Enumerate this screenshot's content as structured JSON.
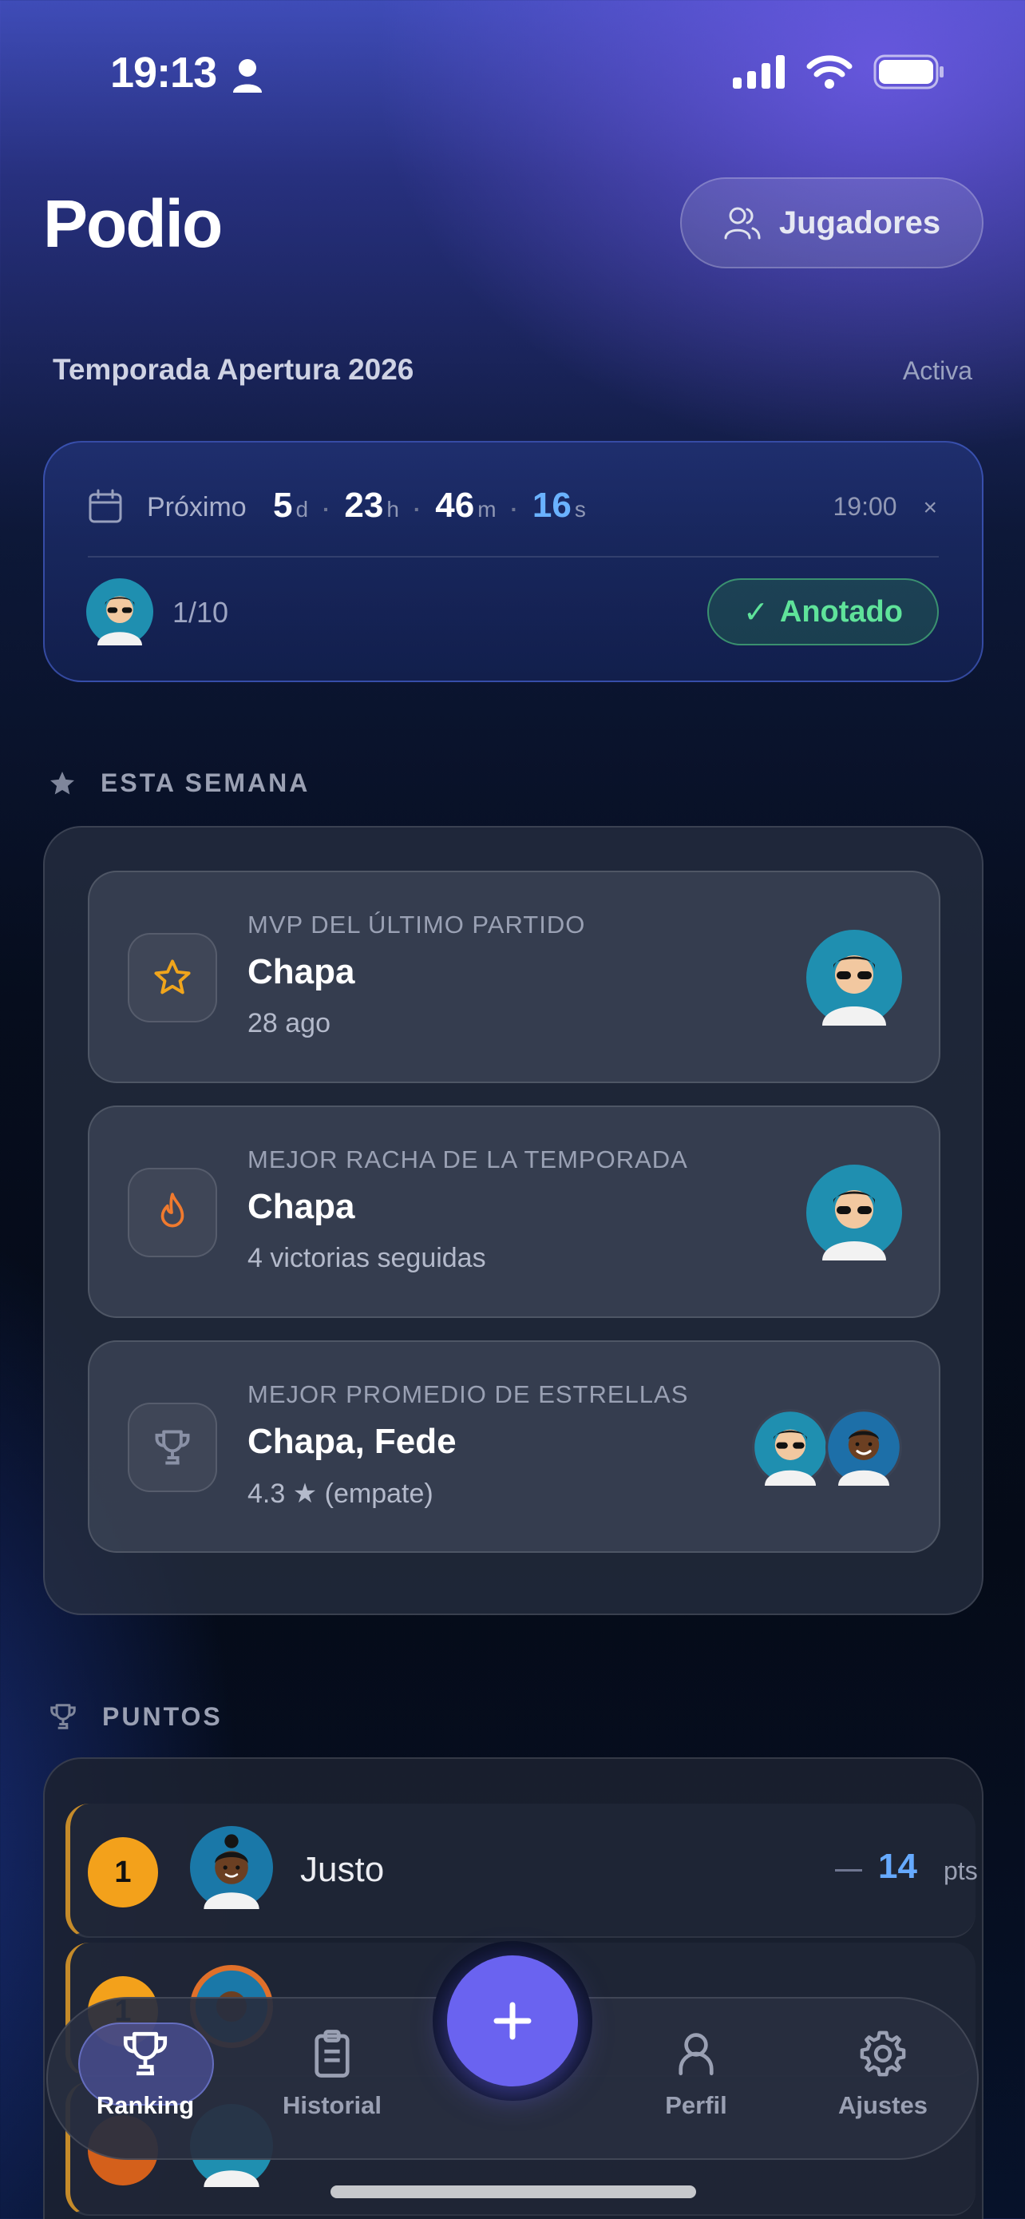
{
  "status_bar": {
    "time": "19:13"
  },
  "header": {
    "title": "Podio",
    "players_button": "Jugadores"
  },
  "season": {
    "name": "Temporada Apertura 2026",
    "status": "Activa"
  },
  "next_match": {
    "label": "Próximo",
    "countdown": {
      "days": "5",
      "days_unit": "d",
      "hours": "23",
      "hours_unit": "h",
      "minutes": "46",
      "minutes_unit": "m",
      "seconds": "16",
      "seconds_unit": "s"
    },
    "time": "19:00",
    "close_glyph": "×",
    "signed_count": "1/10",
    "joined_label": "Anotado",
    "check_glyph": "✓"
  },
  "week": {
    "heading": "ESTA SEMANA",
    "awards": [
      {
        "kicker": "MVP DEL ÚLTIMO PARTIDO",
        "name": "Chapa",
        "sub": "28 ago",
        "icon": "star-icon"
      },
      {
        "kicker": "MEJOR RACHA DE LA TEMPORADA",
        "name": "Chapa",
        "sub": "4 victorias seguidas",
        "icon": "flame-icon"
      },
      {
        "kicker": "MEJOR PROMEDIO DE ESTRELLAS",
        "name": "Chapa, Fede",
        "sub": "4.3 ★ (empate)",
        "icon": "trophy-icon"
      }
    ]
  },
  "points": {
    "heading": "PUNTOS",
    "rows": [
      {
        "rank": "1",
        "name": "Justo",
        "points": "14",
        "unit": "pts",
        "trend": "—"
      },
      {
        "rank": "1",
        "name": "",
        "points": "",
        "unit": "",
        "trend": ""
      }
    ]
  },
  "nav": {
    "items": [
      {
        "label": "Ranking",
        "icon": "trophy-icon"
      },
      {
        "label": "Historial",
        "icon": "clipboard-icon"
      },
      {
        "label": "Perfil",
        "icon": "person-icon"
      },
      {
        "label": "Ajustes",
        "icon": "gear-icon"
      }
    ],
    "fab_icon": "plus-icon"
  },
  "colors": {
    "accent": "#6a63f0",
    "points_blue": "#66aaff",
    "gold": "#f3a11b",
    "joined_green": "#5fe39a"
  }
}
